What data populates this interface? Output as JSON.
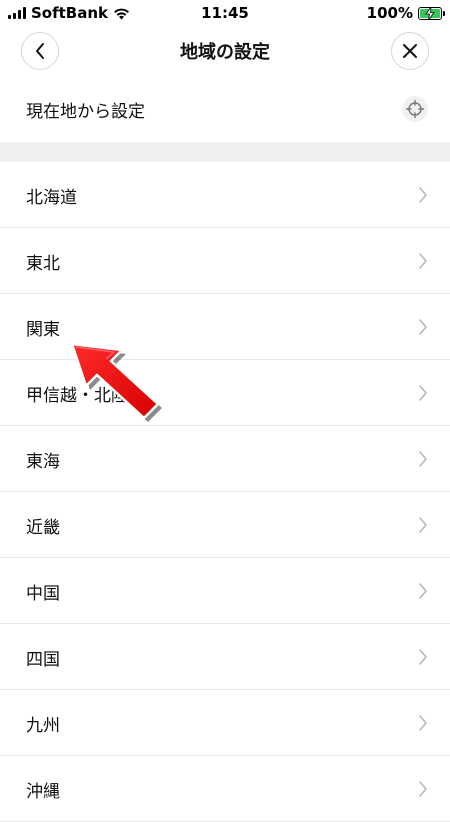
{
  "status_bar": {
    "carrier": "SoftBank",
    "time": "11:45",
    "battery": "100%",
    "battery_color": "#35c759"
  },
  "header": {
    "title": "地域の設定",
    "back_icon": "chevron-left-icon",
    "close_icon": "close-icon"
  },
  "current_location": {
    "label": "現在地から設定",
    "icon": "crosshair-icon"
  },
  "regions": [
    {
      "label": "北海道"
    },
    {
      "label": "東北"
    },
    {
      "label": "関東"
    },
    {
      "label": "甲信越・北陸"
    },
    {
      "label": "東海"
    },
    {
      "label": "近畿"
    },
    {
      "label": "中国"
    },
    {
      "label": "四国"
    },
    {
      "label": "九州"
    },
    {
      "label": "沖縄"
    }
  ],
  "annotation": {
    "icon": "red-pointer-arrow",
    "color": "#e8000e"
  }
}
